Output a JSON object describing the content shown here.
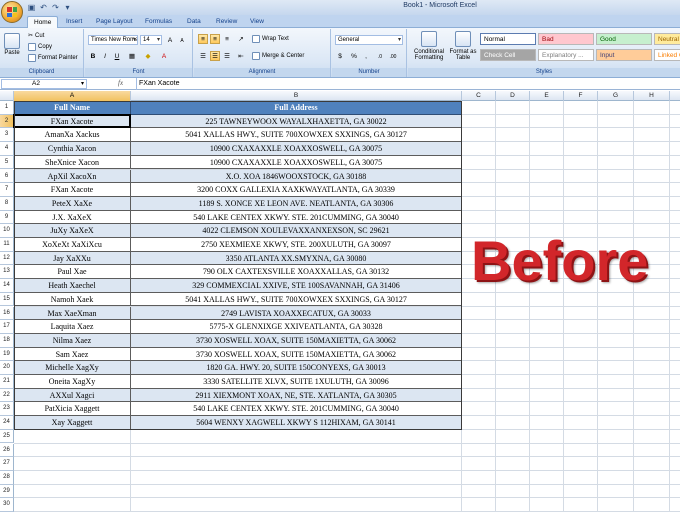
{
  "window": {
    "title": "Book1 - Microsoft Excel"
  },
  "tabs": [
    "Home",
    "Insert",
    "Page Layout",
    "Formulas",
    "Data",
    "Review",
    "View"
  ],
  "ribbon": {
    "clipboard": {
      "label": "Clipboard",
      "paste": "Paste",
      "cut": "Cut",
      "copy": "Copy",
      "format_painter": "Format Painter"
    },
    "font": {
      "label": "Font",
      "name": "Times New Roman",
      "size": "14",
      "bold": "B",
      "italic": "I",
      "underline": "U",
      "grow": "A",
      "shrink": "A"
    },
    "alignment": {
      "label": "Alignment",
      "wrap_text": "Wrap Text",
      "merge_center": "Merge & Center"
    },
    "number": {
      "label": "Number",
      "format": "General",
      "currency": "$",
      "percent": "%",
      "comma": ","
    },
    "styles": {
      "label": "Styles",
      "conditional": "Conditional Formatting",
      "format_table": "Format as Table",
      "cells": [
        {
          "name": "Normal",
          "bg": "#ffffff",
          "fg": "#000000"
        },
        {
          "name": "Bad",
          "bg": "#ffc7ce",
          "fg": "#9c0006"
        },
        {
          "name": "Good",
          "bg": "#c6efce",
          "fg": "#006100"
        },
        {
          "name": "Neutral",
          "bg": "#ffeb9c",
          "fg": "#9c6500"
        },
        {
          "name": "Check Cell",
          "bg": "#a5a5a5",
          "fg": "#ffffff"
        },
        {
          "name": "Explanatory ...",
          "bg": "#ffffff",
          "fg": "#7f7f7f"
        },
        {
          "name": "Input",
          "bg": "#ffcc99",
          "fg": "#3f3f76"
        },
        {
          "name": "Linked Cell",
          "bg": "#ffffff",
          "fg": "#fa7d00"
        }
      ]
    }
  },
  "formula_bar": {
    "name_box": "A2",
    "fx": "fx",
    "value": "FXan Xacote"
  },
  "columns": [
    "A",
    "B",
    "C",
    "D",
    "E",
    "F",
    "G",
    "H"
  ],
  "rows": [
    "1",
    "2",
    "3",
    "4",
    "5",
    "6",
    "7",
    "8",
    "9",
    "10",
    "11",
    "12",
    "13",
    "14",
    "15",
    "16",
    "17",
    "18",
    "19",
    "20",
    "21",
    "22",
    "23",
    "24",
    "25",
    "26",
    "27",
    "28",
    "29",
    "30"
  ],
  "table": {
    "headers": [
      "Full Name",
      "Full Address"
    ],
    "rows": [
      [
        "FXan Xacote",
        "225 TAWNEYWOOX WAYALXHAXETTA, GA 30022"
      ],
      [
        "AmanXa Xackus",
        "5041 XALLAS HWY., SUITE 700XOWXEX SXXINGS, GA 30127"
      ],
      [
        "Cynthia Xacon",
        "10900 CXAXAXXLE XOAXXOSWELL, GA 30075"
      ],
      [
        "SheXnice Xacon",
        "10900 CXAXAXXLE XOAXXOSWELL, GA 30075"
      ],
      [
        "ApXil XacoXn",
        "X.O. XOA 1846WOOXSTOCK, GA 30188"
      ],
      [
        "FXan Xacote",
        "3200 COXX GALLEXIA XAXKWAYATLANTA, GA 30339"
      ],
      [
        "PeteX XaXe",
        "1189 S. XONCE XE LEON AVE. NEATLANTA, GA 30306"
      ],
      [
        "J.X. XaXeX",
        "540 LAKE CENTEX XKWY. STE. 201CUMMING, GA 30040"
      ],
      [
        "JuXy XaXeX",
        "4022 CLEMSON XOULEVAXXANXEXSON, SC 29621"
      ],
      [
        "XoXeXt XaXiXcu",
        "2750 XEXMIEXE XKWY, STE. 200XULUTH, GA 30097"
      ],
      [
        "Jay XaXXu",
        "3350 ATLANTA XX.SMYXNA, GA 30080"
      ],
      [
        "Paul Xae",
        "790 OLX CAXTEXSVILLE XOAXXALLAS, GA 30132"
      ],
      [
        "Heath Xaechel",
        "329 COMMEXCIAL XXIVE, STE 100SAVANNAH, GA 31406"
      ],
      [
        "Namoh Xaek",
        "5041 XALLAS HWY., SUITE 700XOWXEX SXXINGS, GA 30127"
      ],
      [
        "Max XaeXman",
        "2749 LAVISTA XOAXXECATUX, GA 30033"
      ],
      [
        "Laquita Xaez",
        "5775-X GLENXIXGE XXIVEATLANTA, GA 30328"
      ],
      [
        "Nilma Xaez",
        "3730 XOSWELL XOAX, SUITE 150MAXIETTA, GA 30062"
      ],
      [
        "Sam Xaez",
        "3730 XOSWELL XOAX, SUITE 150MAXIETTA, GA 30062"
      ],
      [
        "Michelle XagXy",
        "1820 GA. HWY. 20, SUITE 150CONYEXS, GA 30013"
      ],
      [
        "Oneita XagXy",
        "3330 SATELLITE XLVX, SUITE 1XULUTH, GA 30096"
      ],
      [
        "AXXul Xagci",
        "2911 XIEXMONT XOAX, NE, STE. XATLANTA, GA 30305"
      ],
      [
        "PatXicia Xaggett",
        "540 LAKE CENTEX XKWY. STE. 201CUMMING, GA 30040"
      ],
      [
        "Xay Xaggett",
        "5604 WENXY XAGWELL XKWY S 112HIXAM, GA 30141"
      ]
    ]
  },
  "overlay": {
    "text": "Before",
    "color": "#d2262a"
  }
}
